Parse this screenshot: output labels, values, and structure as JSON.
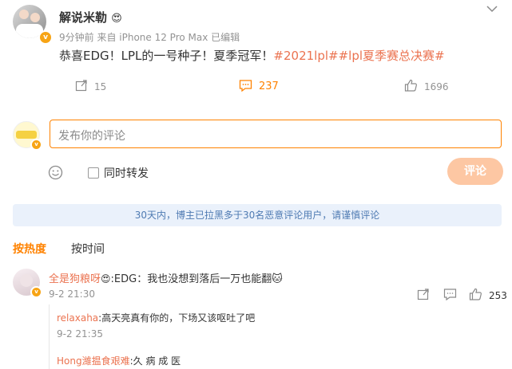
{
  "post": {
    "author": "解说米勒",
    "author_emoji": "😍",
    "meta": "9分钟前 来自 iPhone 12 Pro Max 已编辑",
    "text_plain": "恭喜EDG！LPL的一号种子！夏季冠军！",
    "text_hashtags": "#2021lpl##lpl夏季赛总决赛#",
    "repost_count": "15",
    "comment_count": "237",
    "like_count": "1696"
  },
  "composer": {
    "placeholder": "发布你的评论",
    "repost_label": "同时转发",
    "submit_label": "评论"
  },
  "notice": "30天内，博主已拉黑多于30名恶意评论用户，请谨慎评论",
  "tabs": [
    {
      "label": "按热度"
    },
    {
      "label": "按时间"
    }
  ],
  "comments": [
    {
      "user": "全是狗粮呀",
      "user_emoji": "😍",
      "text": ":EDG：我也没想到落后一万也能翻",
      "text_emoji": "🐱",
      "time": "9-2 21:30",
      "likes": "253",
      "replies": [
        {
          "user": "relaxaha",
          "text": ":高天亮真有你的，下场又该呕吐了吧",
          "time": "9-2 21:35"
        },
        {
          "user": "Hong濰揾食艰难",
          "text": ":久 病 成 医",
          "time": ""
        }
      ]
    }
  ],
  "colors": {
    "accent": "#ff8200",
    "link": "#eb7350",
    "notice_bg": "#eaf1fb"
  }
}
